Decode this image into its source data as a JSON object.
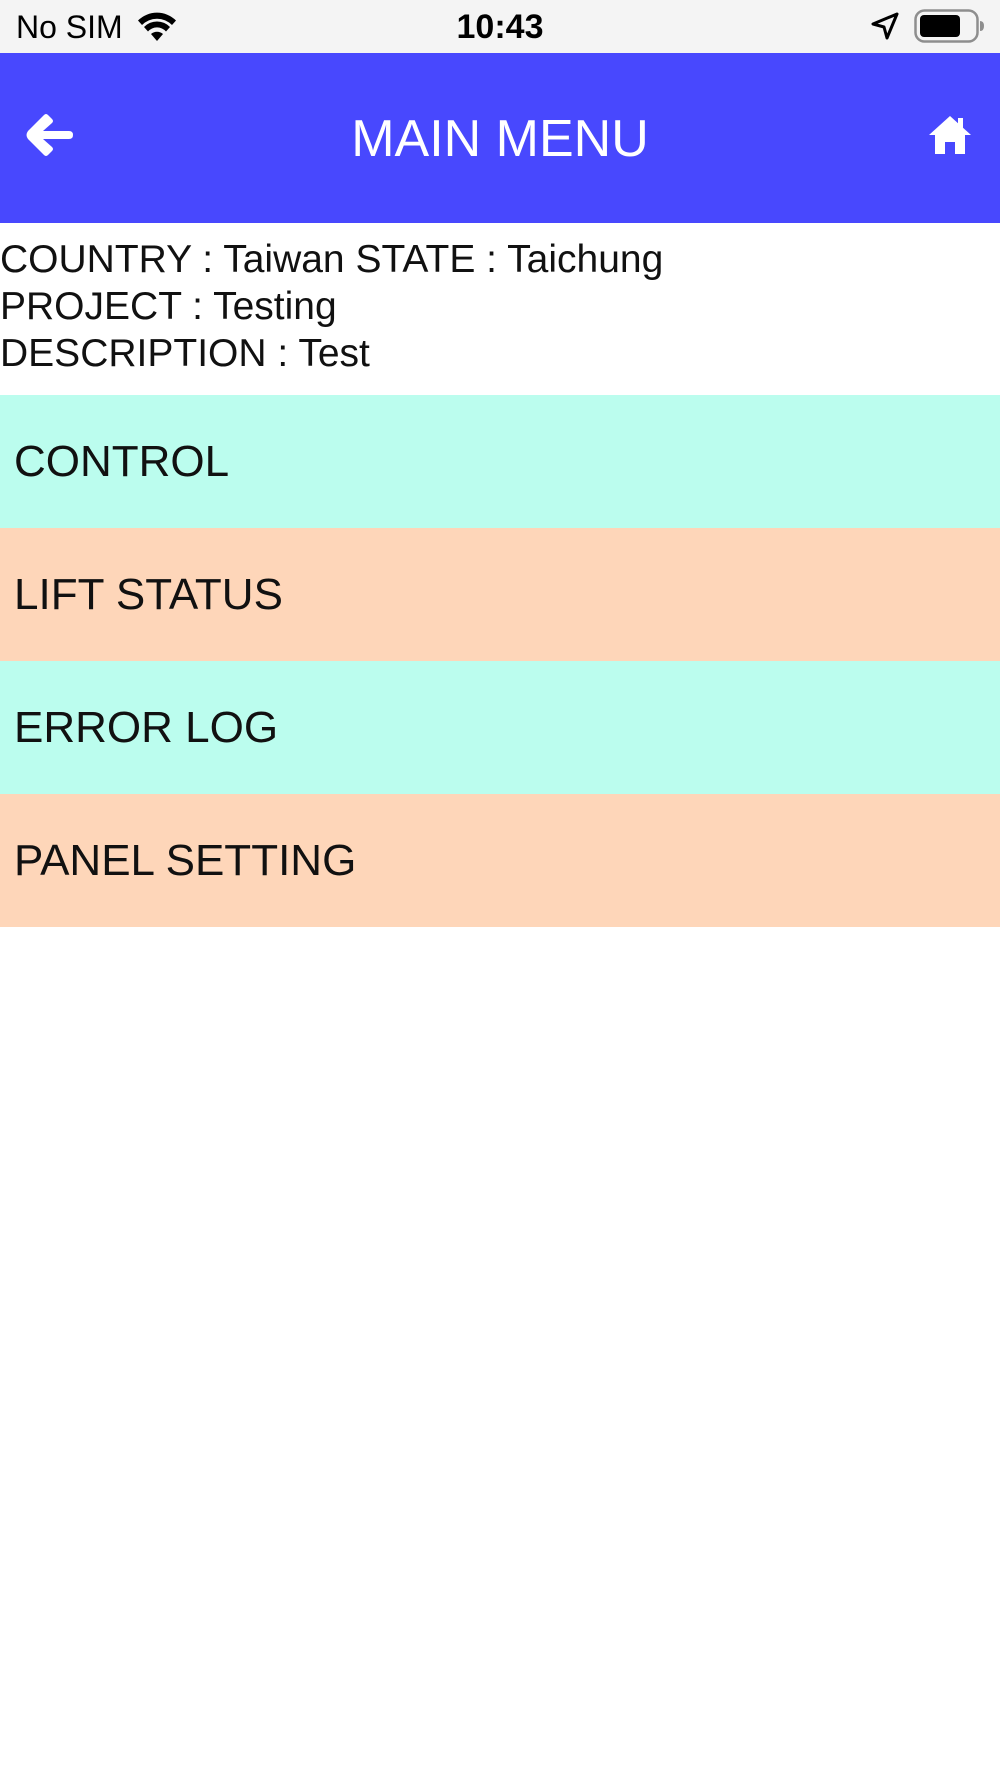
{
  "status_bar": {
    "carrier": "No SIM",
    "time": "10:43",
    "icons": [
      "wifi-icon",
      "location-arrow-icon",
      "battery-icon"
    ]
  },
  "header": {
    "title": "MAIN MENU",
    "back_icon": "arrow-left-icon",
    "home_icon": "home-icon",
    "background_color": "#4848fe"
  },
  "info": {
    "line1": "COUNTRY : Taiwan STATE : Taichung",
    "line2": "PROJECT : Testing",
    "line3": "DESCRIPTION : Test"
  },
  "menu": {
    "items": [
      {
        "label": "CONTROL",
        "color": "#bbfdee"
      },
      {
        "label": "LIFT STATUS",
        "color": "#fed6b9"
      },
      {
        "label": "ERROR LOG",
        "color": "#bbfdee"
      },
      {
        "label": "PANEL SETTING",
        "color": "#fed6b9"
      }
    ]
  }
}
